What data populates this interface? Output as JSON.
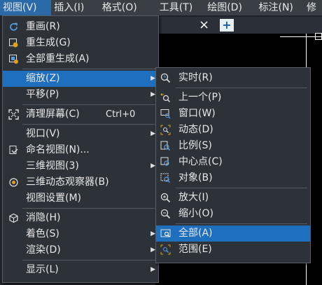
{
  "menubar": {
    "items": [
      "视图(V)",
      "插入(I)",
      "格式(O)",
      "工具(T)",
      "绘图(D)",
      "标注(N)",
      "修"
    ]
  },
  "tab": {
    "close_glyph": "×",
    "new_glyph": "+"
  },
  "view_menu": {
    "items": [
      {
        "label": "重画(R)"
      },
      {
        "label": "重生成(G)"
      },
      {
        "label": "全部重生成(A)"
      },
      {
        "label": "缩放(Z)"
      },
      {
        "label": "平移(P)"
      },
      {
        "label": "清理屏幕(C)",
        "shortcut": "Ctrl+0"
      },
      {
        "label": "视口(V)"
      },
      {
        "label": "命名视图(N)..."
      },
      {
        "label": "三维视图(3)"
      },
      {
        "label": "三维动态观察器(B)"
      },
      {
        "label": "视图设置(M)"
      },
      {
        "label": "消隐(H)"
      },
      {
        "label": "着色(S)"
      },
      {
        "label": "渲染(D)"
      },
      {
        "label": "显示(L)"
      }
    ]
  },
  "zoom_menu": {
    "items": [
      {
        "label": "实时(R)"
      },
      {
        "label": "上一个(P)"
      },
      {
        "label": "窗口(W)"
      },
      {
        "label": "动态(D)"
      },
      {
        "label": "比例(S)"
      },
      {
        "label": "中心点(C)"
      },
      {
        "label": "对象(B)"
      },
      {
        "label": "放大(I)"
      },
      {
        "label": "缩小(O)"
      },
      {
        "label": "全部(A)"
      },
      {
        "label": "范围(E)"
      }
    ]
  },
  "colors": {
    "highlight": "#1f6fbf",
    "menu_bg": "#2d3239",
    "menubar_bg": "#3a3f46",
    "canvas": "#000000"
  }
}
